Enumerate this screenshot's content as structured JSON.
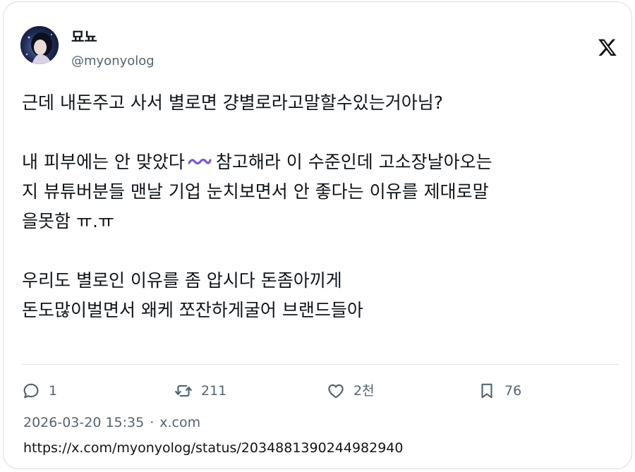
{
  "author": {
    "display_name": "묘뇨",
    "handle": "@myonyolog"
  },
  "tweet": {
    "line1": "근데 내돈주고 사서 별로면 걍별로라고말할수있는거아님?",
    "line2a": "내 피부에는 안 맞았다",
    "line2b": "참고해라 이 수준인데 고소장날아오는",
    "line3": "지 뷰튜버분들 맨날 기업 눈치보면서 안 좋다는 이유를 제대로말",
    "line4": "을못함 ㅠ.ㅠ",
    "line5": "우리도 별로인 이유를 좀 압시다 돈좀아끼게",
    "line6": "돈도많이벌면서 왜케 쪼잔하게굴어 브랜드들아"
  },
  "actions": {
    "replies": "1",
    "reposts": "211",
    "likes": "2천",
    "bookmarks": "76"
  },
  "meta": {
    "timestamp": "2026-03-20 15:35",
    "separator": "·",
    "source": "x.com"
  },
  "status_url": "https://x.com/myonyolog/status/2034881390244982940",
  "colors": {
    "text": "#0f1419",
    "secondary": "#536471",
    "border": "#d7dde1",
    "wave_emoji": "#7b5cc7"
  },
  "icons": {
    "logo": "x-logo-icon",
    "reply": "reply-icon",
    "repost": "repost-icon",
    "like": "heart-icon",
    "bookmark": "bookmark-icon",
    "wave": "wavy-dash-icon"
  }
}
